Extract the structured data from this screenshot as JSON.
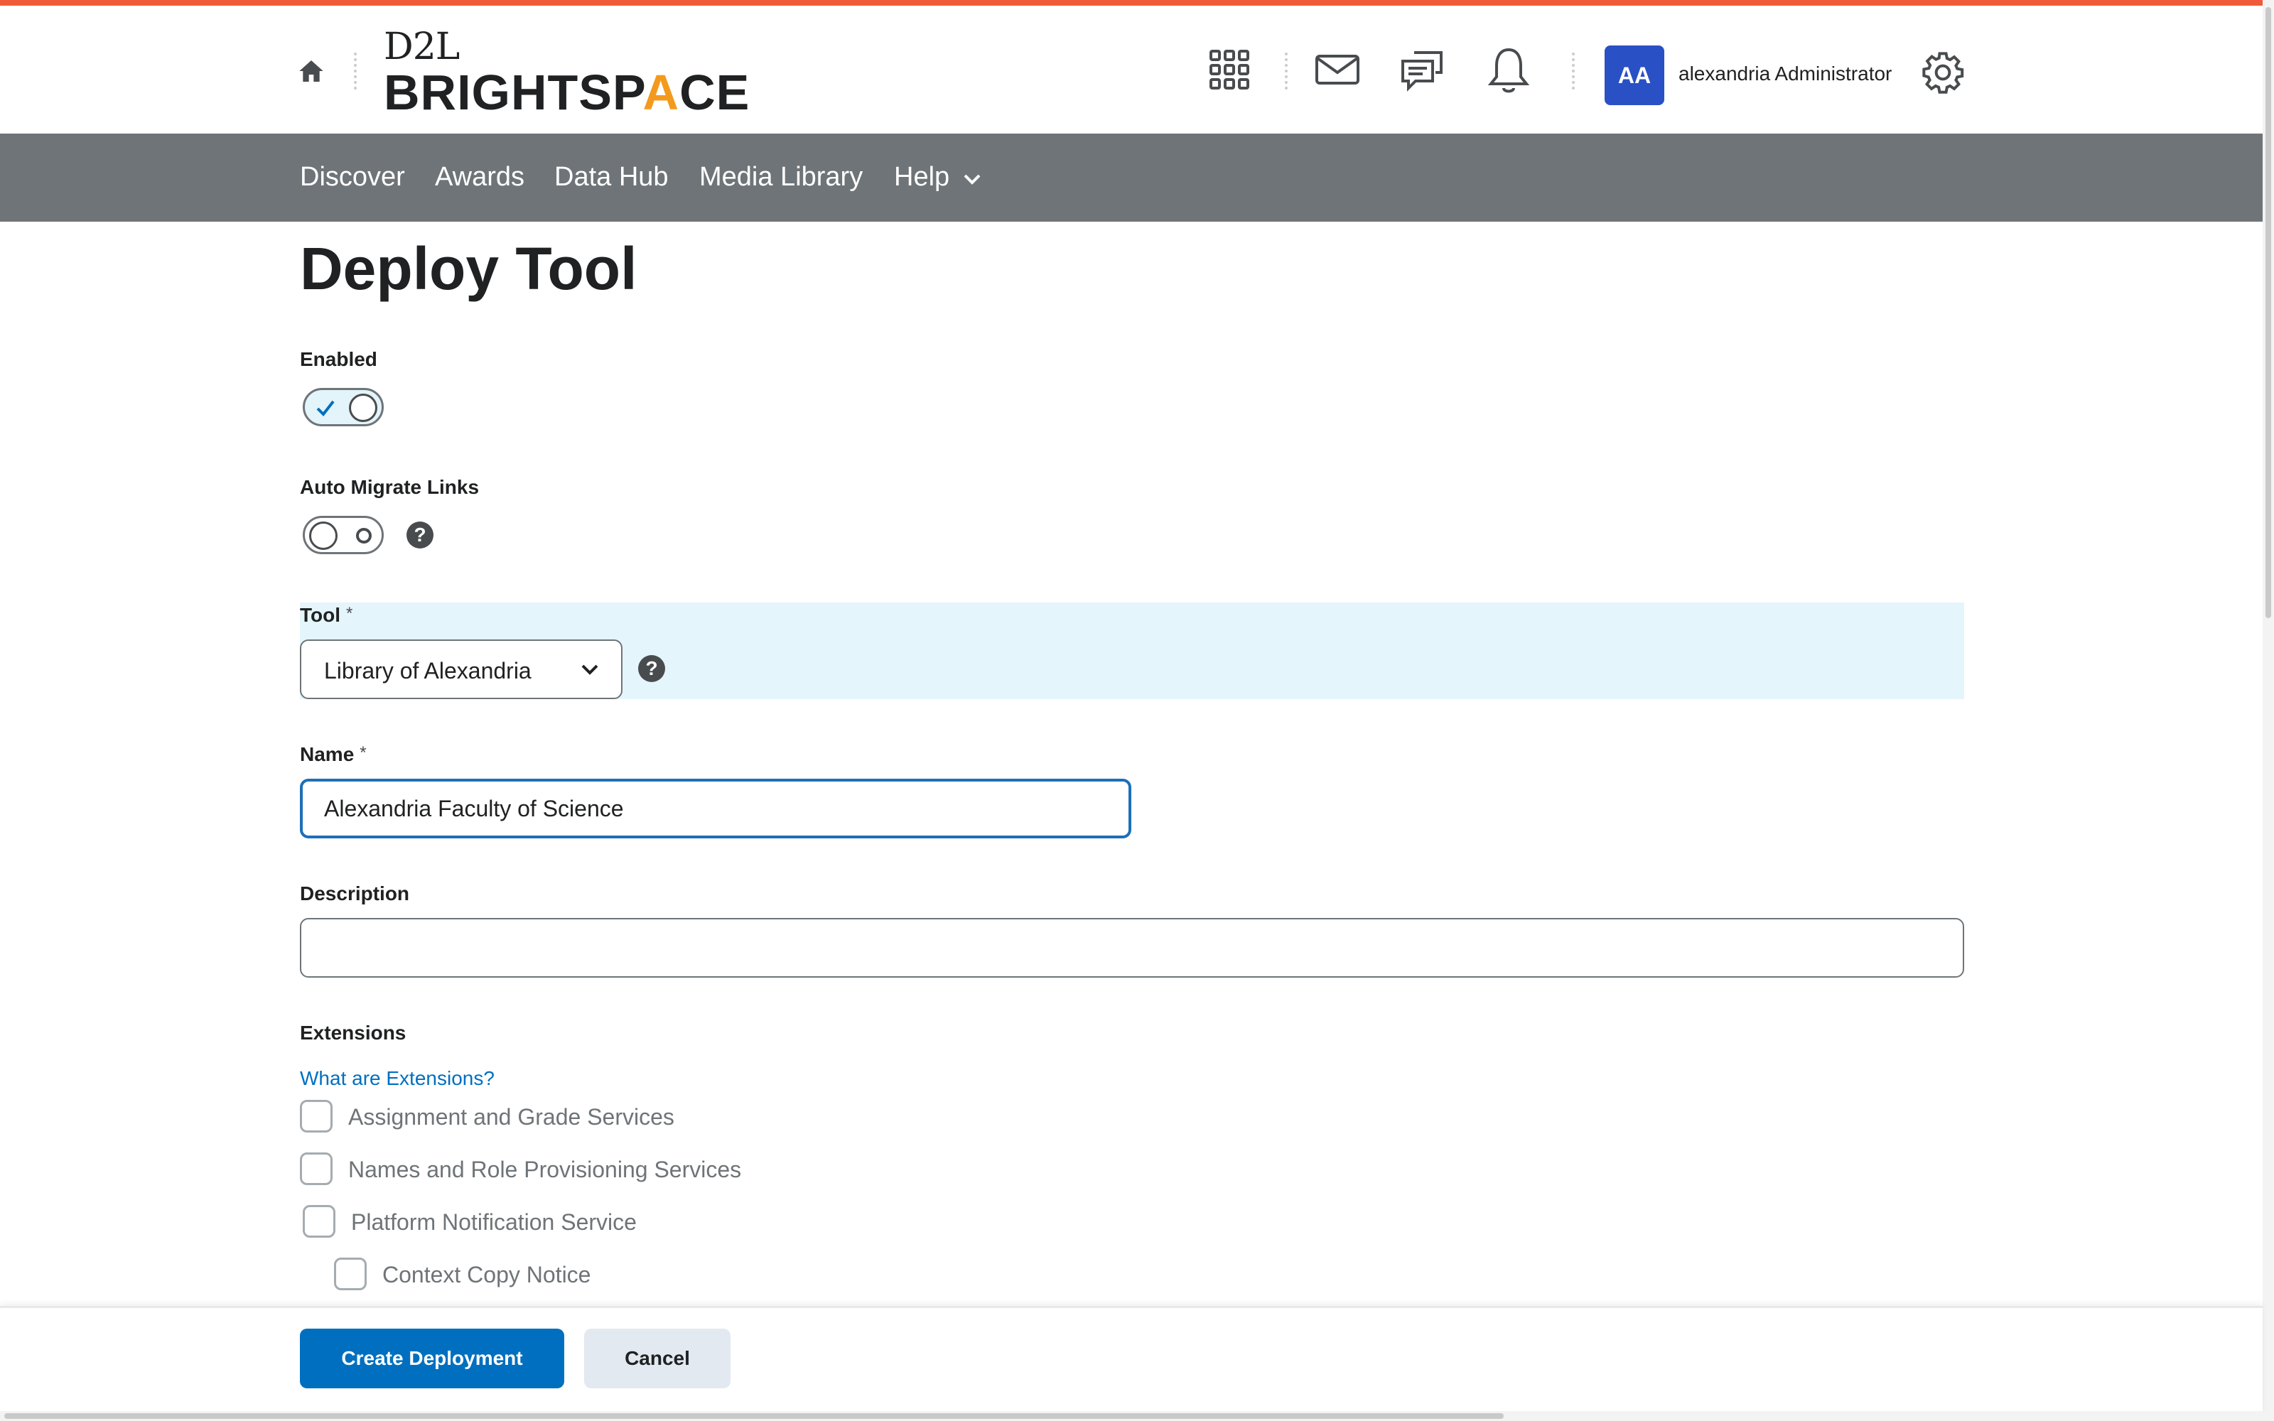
{
  "brand": {
    "logo_top": "D2L",
    "logo_main_before": "BRIGHTSP",
    "logo_main_accent": "A",
    "logo_main_after": "CE",
    "accent_color": "#f05a3a",
    "primary_color": "#006fbf"
  },
  "header": {
    "icons": [
      "home-icon",
      "apps-grid-icon",
      "mail-icon",
      "chat-icon",
      "bell-icon",
      "gear-icon"
    ],
    "user": {
      "initials": "AA",
      "name": "alexandria Administrator"
    }
  },
  "nav": {
    "items": [
      {
        "label": "Discover"
      },
      {
        "label": "Awards"
      },
      {
        "label": "Data Hub"
      },
      {
        "label": "Media Library"
      },
      {
        "label": "Help"
      }
    ]
  },
  "page": {
    "title": "Deploy Tool"
  },
  "form": {
    "enabled": {
      "label": "Enabled",
      "checked": true
    },
    "auto_migrate": {
      "label": "Auto Migrate Links",
      "checked": false
    },
    "tool": {
      "label": "Tool",
      "required_mark": "*",
      "value": "Library of Alexandria"
    },
    "name": {
      "label": "Name",
      "required_mark": "*",
      "value": "Alexandria Faculty of Science"
    },
    "description": {
      "label": "Description",
      "value": ""
    },
    "extensions": {
      "label": "Extensions",
      "help_link": "What are Extensions?",
      "items": [
        {
          "label": "Assignment and Grade Services",
          "checked": false
        },
        {
          "label": "Names and Role Provisioning Services",
          "checked": false
        },
        {
          "label": "Platform Notification Service",
          "checked": false
        },
        {
          "label": "Context Copy Notice",
          "checked": false
        }
      ]
    }
  },
  "footer": {
    "create_label": "Create Deployment",
    "cancel_label": "Cancel"
  }
}
